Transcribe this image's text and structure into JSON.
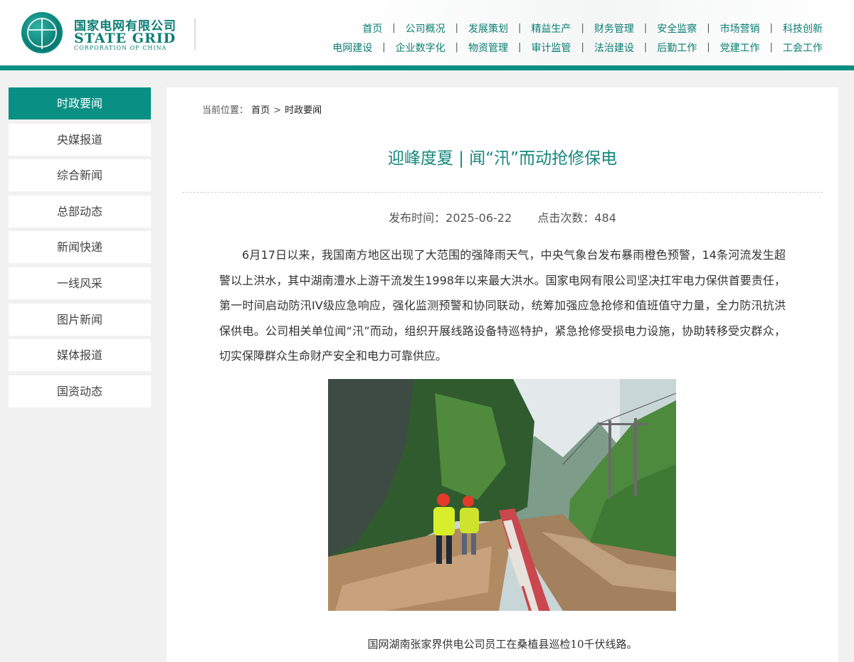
{
  "brand": {
    "name_cn": "国家电网有限公司",
    "name_en": "STATE GRID",
    "name_sub": "CORPORATION OF CHINA"
  },
  "nav": {
    "row1": [
      "首页",
      "公司概况",
      "发展策划",
      "精益生产",
      "财务管理",
      "安全监察",
      "市场营销",
      "科技创新"
    ],
    "row2": [
      "电网建设",
      "企业数字化",
      "物资管理",
      "审计监管",
      "法治建设",
      "后勤工作",
      "党建工作",
      "工会工作"
    ],
    "separator": "|"
  },
  "sidebar": {
    "items": [
      {
        "label": "时政要闻",
        "active": true
      },
      {
        "label": "央媒报道",
        "active": false
      },
      {
        "label": "综合新闻",
        "active": false
      },
      {
        "label": "总部动态",
        "active": false
      },
      {
        "label": "新闻快递",
        "active": false
      },
      {
        "label": "一线风采",
        "active": false
      },
      {
        "label": "图片新闻",
        "active": false
      },
      {
        "label": "媒体报道",
        "active": false
      },
      {
        "label": "国资动态",
        "active": false
      }
    ]
  },
  "breadcrumb": {
    "prefix": "当前位置：",
    "home": "首页",
    "separator": ">",
    "current": "时政要闻"
  },
  "article": {
    "title": "迎峰度夏 | 闻“汛”而动抢修保电",
    "publish_label": "发布时间：",
    "publish_date": "2025-06-22",
    "hits_label": "点击次数：",
    "hits": "484",
    "paragraph": "6月17日以来，我国南方地区出现了大范围的强降雨天气，中央气象台发布暴雨橙色预警，14条河流发生超警以上洪水，其中湖南澧水上游干流发生1998年以来最大洪水。国家电网有限公司坚决扛牢电力保供首要责任，第一时间启动防汛IV级应急响应，强化监测预警和协同联动，统筹加强应急抢修和值班值守力量，全力防汛抗洪保供电。公司相关单位闻“汛”而动，组织开展线路设备特巡特护，紧急抢修受损电力设施，协助转移受灾群众，切实保障群众生命财产安全和电力可靠供应。",
    "photo_caption": "国网湖南张家界供电公司员工在桑植县巡检10千伏线路。"
  },
  "colors": {
    "brand_teal": "#0a8f84",
    "title_teal": "#16877d"
  }
}
